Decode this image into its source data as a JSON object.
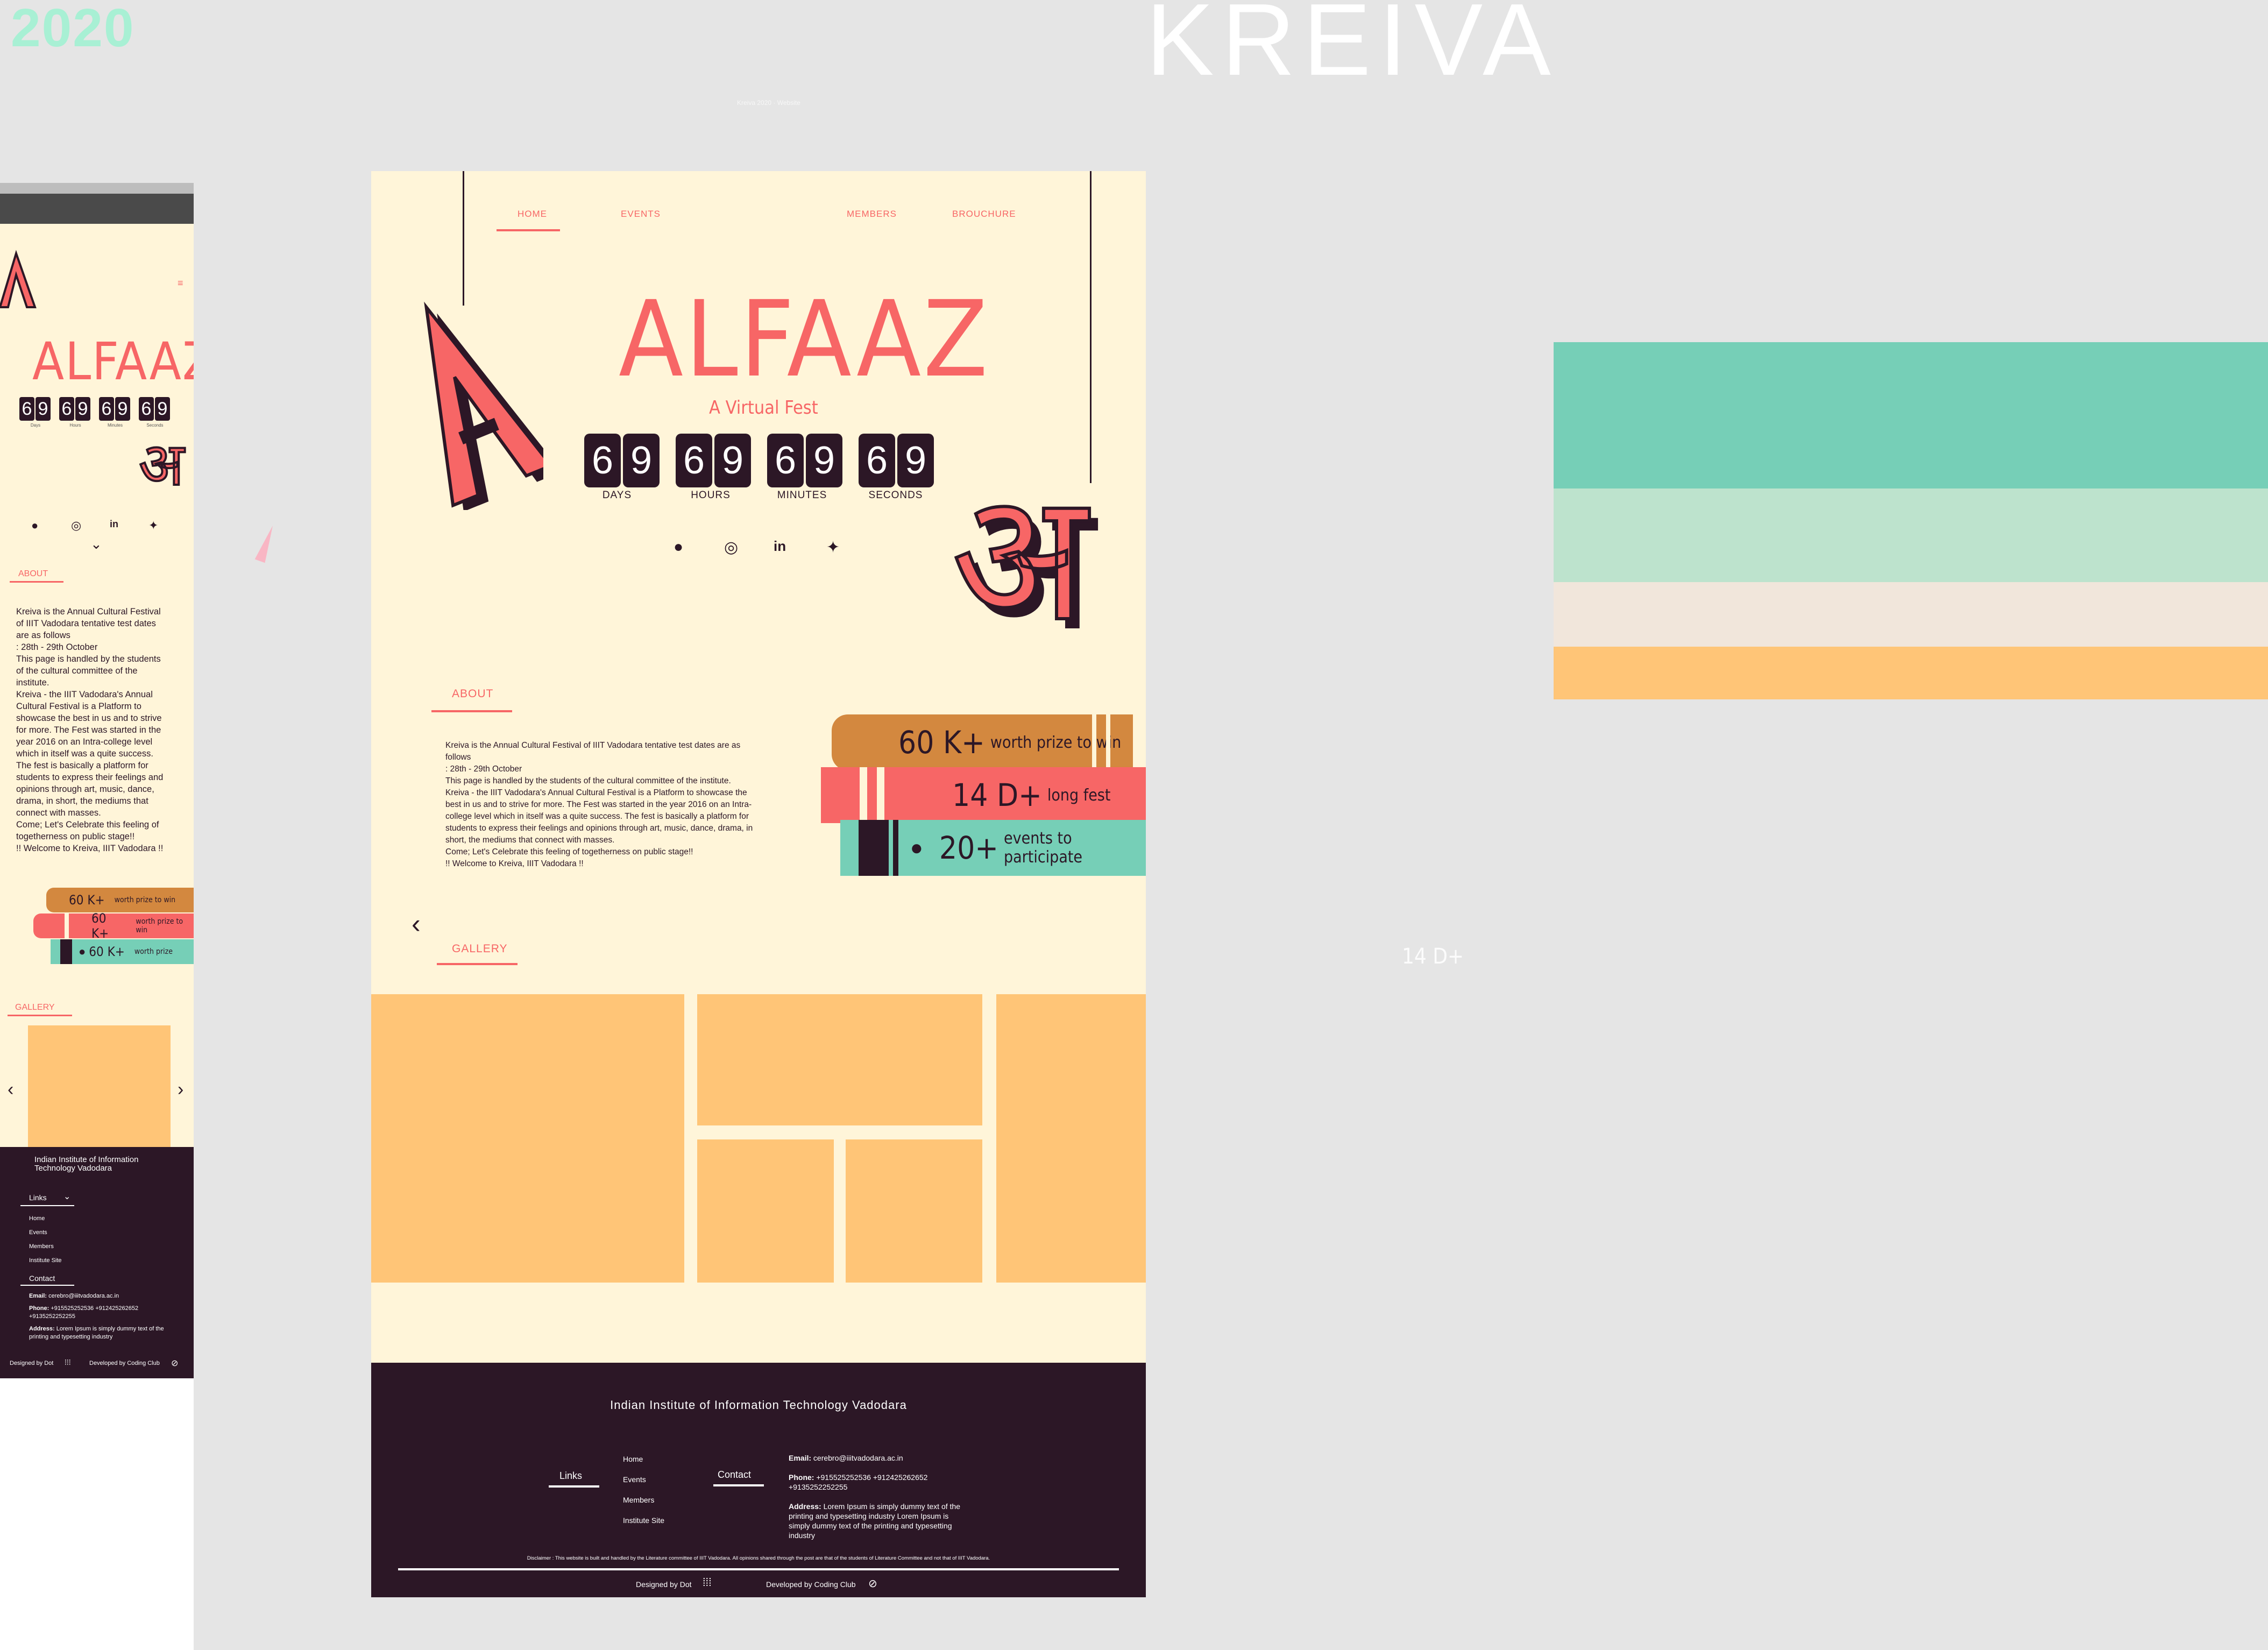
{
  "header": {
    "year": "2020",
    "brand": "KREIVA",
    "subtitle": "Kreiva 2020 · Website"
  },
  "nav": [
    "HOME",
    "EVENTS",
    "MEMBERS",
    "BROUCHURE"
  ],
  "hero": {
    "title": "ALFAAZ",
    "tagline": "A Virtual Fest",
    "countdown": [
      {
        "value": "69",
        "label": "DAYS"
      },
      {
        "value": "69",
        "label": "HOURS"
      },
      {
        "value": "69",
        "label": "MINUTES"
      },
      {
        "value": "69",
        "label": "SECONDS"
      }
    ],
    "social_icons": [
      "facebook-icon",
      "instagram-icon",
      "linkedin-icon",
      "twitter-icon"
    ]
  },
  "about": {
    "label": "ABOUT",
    "lines": [
      "Kreiva is the Annual Cultural Festival of IIIT Vadodara tentative test dates are as follows",
      " : 28th - 29th October",
      "This page is handled by the students of the cultural committee of the institute.",
      "Kreiva - the IIIT Vadodara's Annual Cultural Festival is a Platform to showcase the best in us and to strive for more. The Fest was started in the year 2016 on an Intra-college level which in itself was a quite success. The fest is basically a platform for students to express their feelings and opinions through art, music, dance, drama, in short, the mediums that connect with masses.",
      "Come; Let's Celebrate this feeling of togetherness on public stage!!",
      "!! Welcome to Kreiva, IIIT Vadodara !!"
    ]
  },
  "stats": [
    {
      "num": "60 K+",
      "text": "worth prize to win"
    },
    {
      "num": "14 D+",
      "text": "long fest"
    },
    {
      "num": "20+",
      "text": "events to participate"
    }
  ],
  "mobile_stats": [
    {
      "num": "60 K+",
      "text": "worth prize to win"
    },
    {
      "num": "60 K+",
      "text": "worth prize to win"
    },
    {
      "num": "60 K+",
      "text": "worth prize"
    }
  ],
  "mobile_countdown_labels": [
    "Days",
    "Hours",
    "Minutes",
    "Seconds"
  ],
  "gallery": {
    "label": "GALLERY"
  },
  "footer": {
    "institute": "Indian Institute of Information Technology Vadodara",
    "links_label": "Links",
    "links": [
      "Home",
      "Events",
      "Members",
      "Institute Site"
    ],
    "contact_label": "Contact",
    "email_label": "Email:",
    "email": "cerebro@iiitvadodara.ac.in",
    "phone_label": "Phone:",
    "phone": "+915525252536  +912425262652 +9135252252255",
    "address_label": "Address:",
    "address": "Lorem Ipsum is simply dummy text of the printing and typesetting industry Lorem Ipsum is simply dummy text of the printing and typesetting industry",
    "mobile_address": "Lorem Ipsum is simply dummy text of the printing and typesetting industry",
    "disclaimer": "Disclaimer : This website is built and handled by the Literature committee of IIIT Vadodara. All opinions shared through the post are that of the students of Literature Committee and not that of IIIT Vadodara.",
    "designed": "Designed by Dot",
    "developed": "Developed by Coding Club"
  },
  "ghost_text": "14 D+",
  "palette": [
    "#76cfb7",
    "#bde3cd",
    "#f1e6db",
    "#ffc577"
  ],
  "colors": {
    "accent": "#f76666",
    "dark": "#2c1726",
    "cream": "#fff5d9",
    "orange": "#d3883f",
    "teal": "#76cfb7"
  }
}
